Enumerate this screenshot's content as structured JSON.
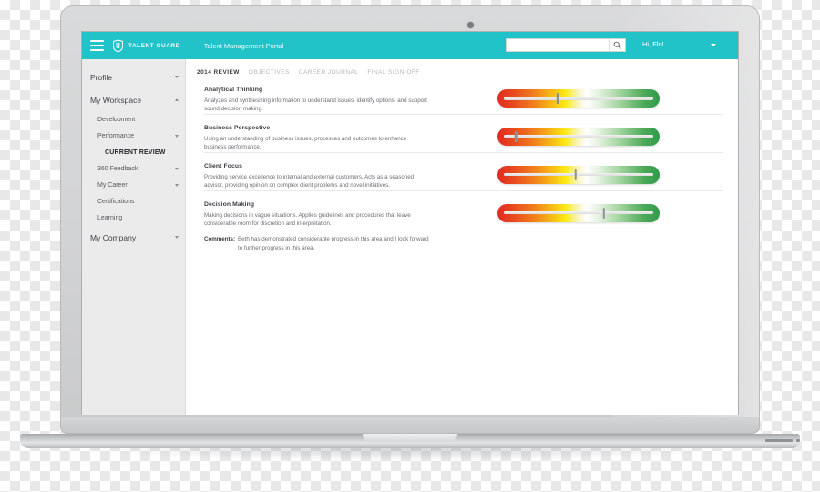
{
  "app": {
    "brand": "TALENT GUARD",
    "portal_title": "Talent Management Portal",
    "greeting": "Hi, Flo!",
    "menu_icon": "hamburger-icon",
    "logo_icon": "shield-logo-icon"
  },
  "search": {
    "value": "",
    "placeholder": "",
    "icon": "search-icon"
  },
  "sidebar": {
    "items": [
      {
        "label": "Profile",
        "level": 1,
        "caret": "down"
      },
      {
        "label": "My Workspace",
        "level": 1,
        "caret": "up"
      },
      {
        "label": "Development",
        "level": 2,
        "caret": ""
      },
      {
        "label": "Performance",
        "level": 2,
        "caret": "down"
      },
      {
        "label": "CURRENT REVIEW",
        "level": 3,
        "caret": ""
      },
      {
        "label": "360 Feedback",
        "level": 2,
        "caret": "down"
      },
      {
        "label": "My Career",
        "level": 2,
        "caret": "down"
      },
      {
        "label": "Certifications",
        "level": 2,
        "caret": ""
      },
      {
        "label": "Learning",
        "level": 2,
        "caret": ""
      },
      {
        "label": "My Company",
        "level": 1,
        "caret": "down"
      }
    ]
  },
  "tabs": [
    {
      "label": "2014 REVIEW",
      "active": true
    },
    {
      "label": "OBJECTIVES",
      "active": false
    },
    {
      "label": "CAREER JOURNAL",
      "active": false
    },
    {
      "label": "FINAL SIGN-OFF",
      "active": false
    }
  ],
  "competencies": [
    {
      "title": "Analytical Thinking",
      "description": "Analyzes and synthesizing information to understand issues, identify options, and support sound decision making.",
      "rating_percent": 36
    },
    {
      "title": "Business Perspective",
      "description": "Using an understanding of business issues, processes and outcomes to enhance business performance.",
      "rating_percent": 8
    },
    {
      "title": "Client Focus",
      "description": "Providing service excellence to internal and external customers. Acts as a seasoned advisor, providing opinion on complex client problems and novel initiatives.",
      "rating_percent": 48
    },
    {
      "title": "Decision Making",
      "description": "Making decisions in vague situations. Applies guidelines and procedures that leave considerable room for discretion and interpretation.",
      "rating_percent": 67,
      "comments_label": "Comments:",
      "comments_text": "Beth has demonstrated considerable progress in this area and I look forward to further progress in this area."
    }
  ],
  "colors": {
    "brand_teal": "#21c3c8",
    "sidebar_bg": "#ebebec",
    "scale_low": "#e02b20",
    "scale_mid": "#fcea14",
    "scale_high": "#2e9b4a"
  }
}
